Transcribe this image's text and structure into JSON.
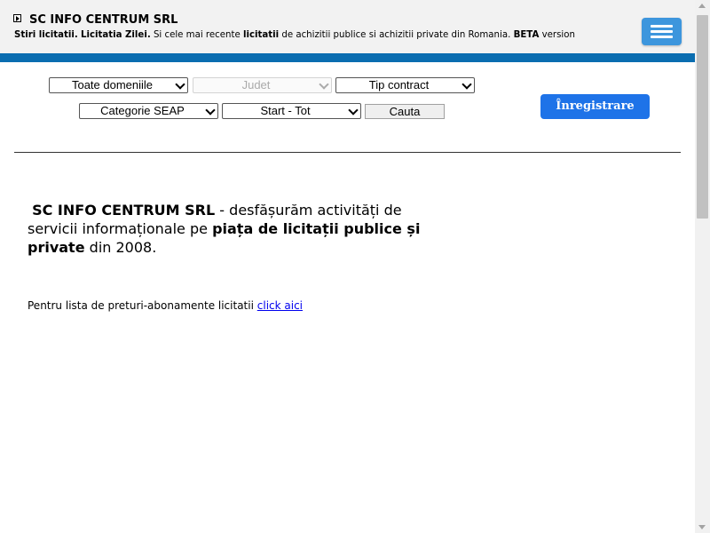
{
  "header": {
    "title": "SC INFO CENTRUM SRL",
    "subtitle": {
      "bold1": "Stiri licitatii.",
      "bold2": "Licitatia Zilei.",
      "text1": "Si cele mai recente",
      "bold3": "licitatii",
      "text2": "de achizitii publice si achizitii private din Romania.",
      "bold4": "BETA",
      "text3": "version"
    },
    "accent_color": "#0a6db0",
    "menu_icon": "hamburger-menu-icon"
  },
  "filters": {
    "domenii": "Toate domeniile",
    "judet": "Judet",
    "tip_contract": "Tip contract",
    "categorie": "Categorie SEAP",
    "start": "Start - Tot",
    "search_button": "Cauta"
  },
  "register_button": "Înregistrare",
  "register_color": "#1e73e8",
  "intro": {
    "company": "SC INFO CENTRUM SRL",
    "text1": "- desfășurăm activități de servicii informaționale pe",
    "market": "piața de licitații  publice și private",
    "text2": "din 2008."
  },
  "price_line": {
    "text": "Pentru lista de preturi-abonamente licitatii",
    "link": "click aici"
  }
}
